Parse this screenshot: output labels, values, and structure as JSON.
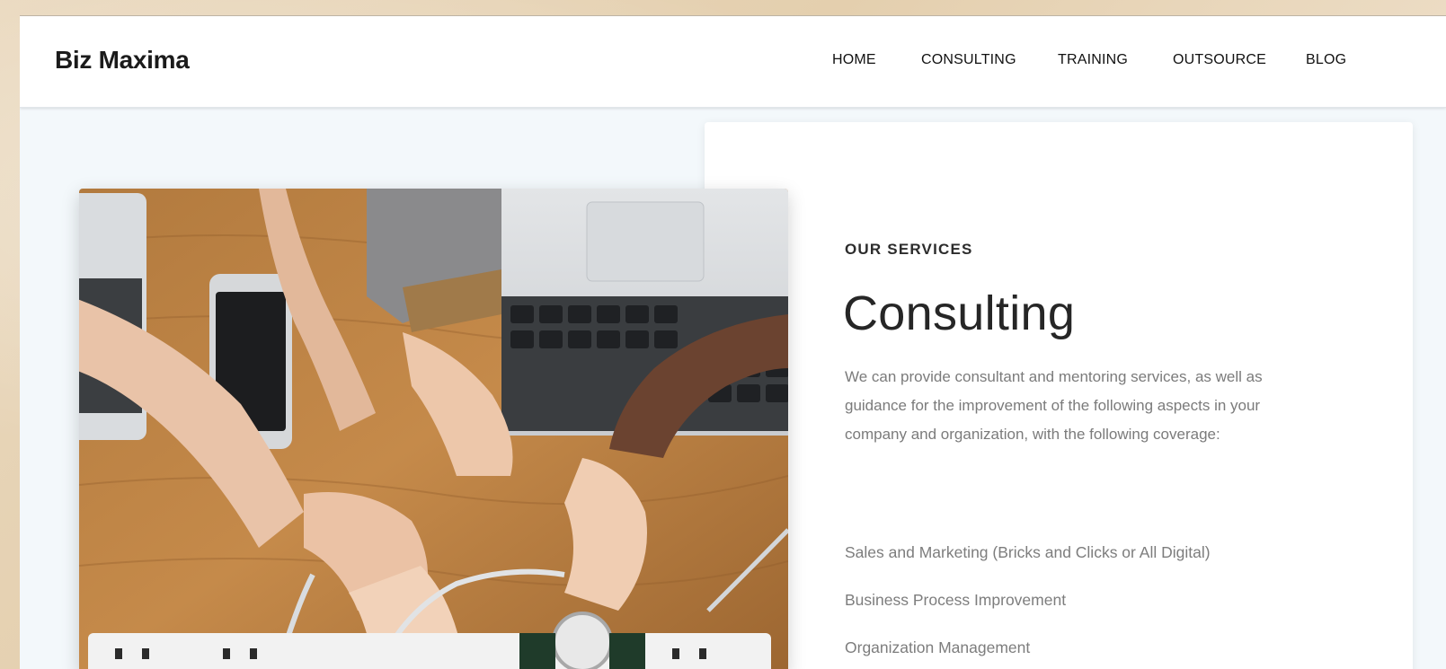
{
  "header": {
    "logo": "Biz Maxima",
    "nav": [
      {
        "label": "HOME",
        "key": "home"
      },
      {
        "label": "CONSULTING",
        "key": "consulting"
      },
      {
        "label": "TRAINING",
        "key": "training"
      },
      {
        "label": "OUTSOURCE",
        "key": "outsource"
      },
      {
        "label": "BLOG",
        "key": "blog"
      }
    ]
  },
  "services": {
    "eyebrow": "OUR SERVICES",
    "title": "Consulting",
    "intro": "We can provide consultant and mentoring services, as well as guidance for the improvement of the following aspects in your company and organization, with the following coverage:",
    "coverage": [
      "Sales and Marketing (Bricks and Clicks or All Digital)",
      "Business Process Improvement",
      "Organization Management"
    ]
  },
  "colors": {
    "page_background": "#f3f8fb",
    "header_background": "#ffffff",
    "heading_text": "#262626",
    "body_text": "#7b7b7b"
  }
}
